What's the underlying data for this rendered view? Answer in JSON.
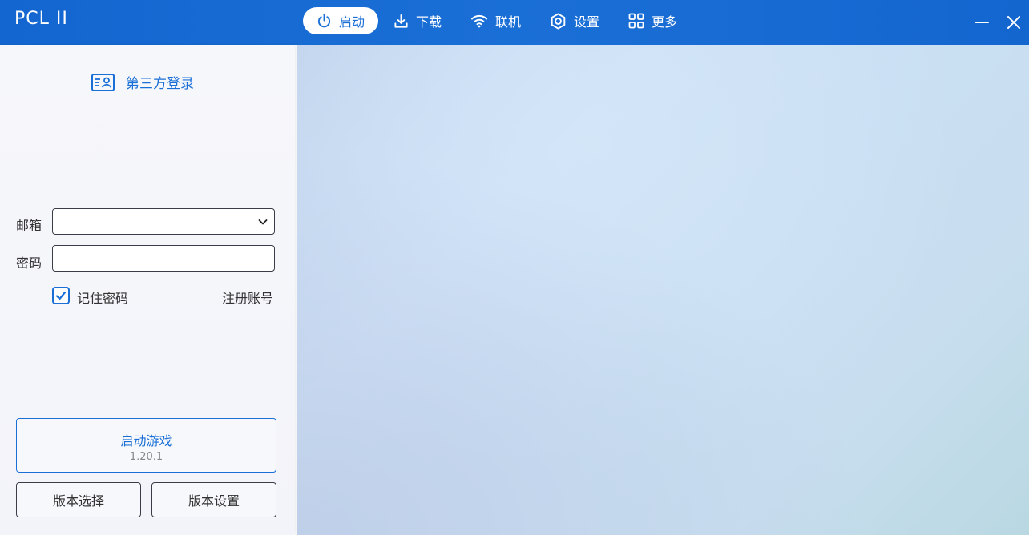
{
  "app": {
    "title": "PCL II"
  },
  "nav": {
    "items": [
      {
        "label": "启动",
        "icon": "power-icon",
        "active": true
      },
      {
        "label": "下载",
        "icon": "download-icon",
        "active": false
      },
      {
        "label": "联机",
        "icon": "wifi-icon",
        "active": false
      },
      {
        "label": "设置",
        "icon": "settings-icon",
        "active": false
      },
      {
        "label": "更多",
        "icon": "grid-icon",
        "active": false
      }
    ]
  },
  "window": {
    "minimize_icon": "minimize-icon",
    "close_icon": "close-icon"
  },
  "login": {
    "title": "第三方登录",
    "title_icon": "id-card-icon",
    "email_label": "邮箱",
    "email_value": "",
    "password_label": "密码",
    "password_value": "",
    "remember_label": "记住密码",
    "remember_checked": true,
    "register_label": "注册账号"
  },
  "launch": {
    "title": "启动游戏",
    "version": "1.20.1",
    "version_select_label": "版本选择",
    "version_settings_label": "版本设置"
  },
  "colors": {
    "accent": "#1a6fd6",
    "titlebar": "#1366cf",
    "panel": "#f5f6fa",
    "border": "#3a3d48"
  }
}
